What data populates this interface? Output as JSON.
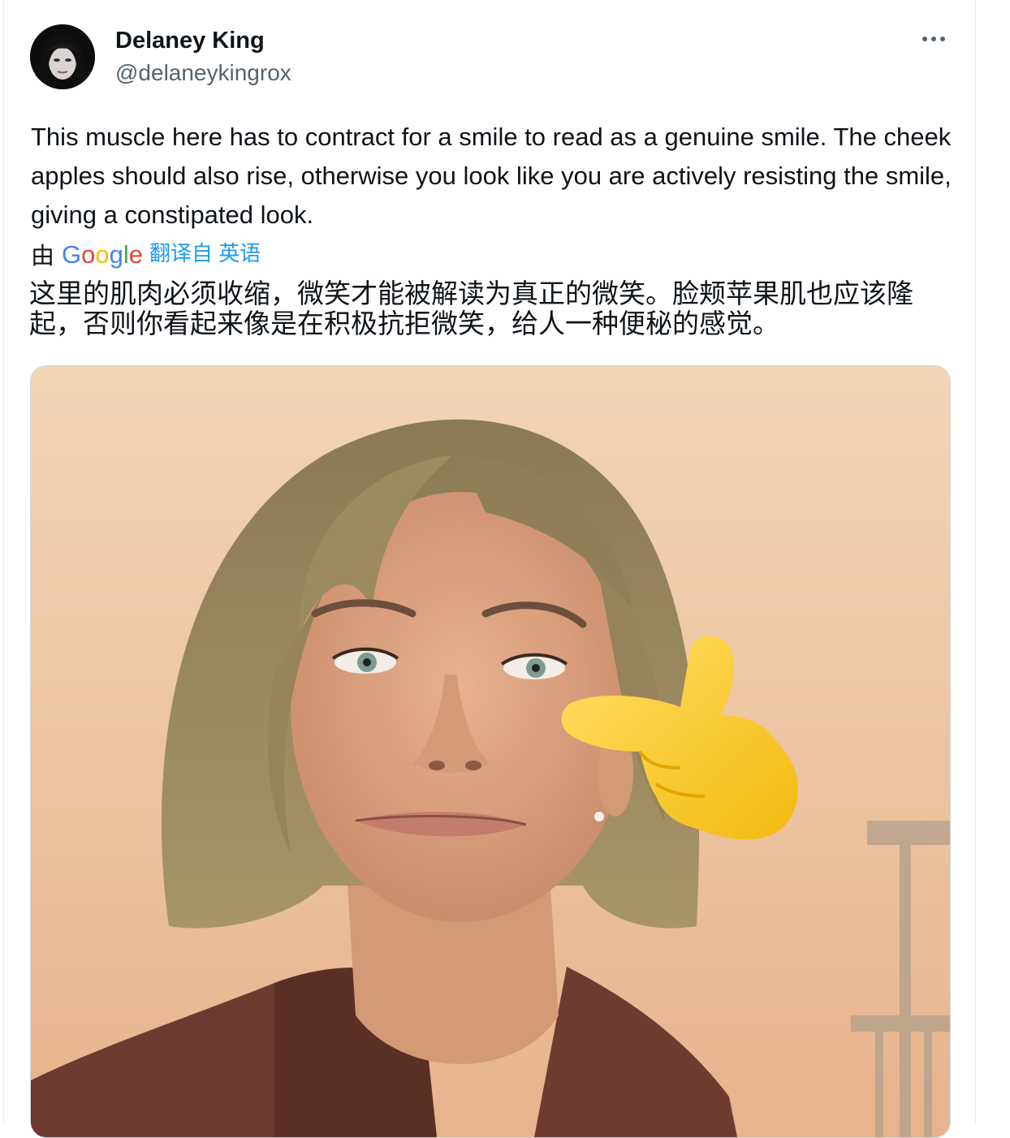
{
  "tweet": {
    "author": {
      "display_name": "Delaney King",
      "handle": "@delaneykingrox"
    },
    "text": "This muscle here has to contract for a smile to read as a genuine smile. The cheek apples should also rise, otherwise you look like you are actively resisting the smile, giving a constipated look.",
    "translation": {
      "by_label": "由",
      "provider": "Google",
      "translated_from_label": "翻译自 英语",
      "text": "这里的肌肉必须收缩，微笑才能被解读为真正的微笑。脸颊苹果肌也应该隆起，否则你看起来像是在积极抗拒微笑，给人一种便秘的感觉。"
    }
  },
  "icons": {
    "more": "more-options-icon",
    "pointing_hand": "backhand-index-pointing-left-icon"
  },
  "colors": {
    "text_primary": "#0f1419",
    "text_secondary": "#536471",
    "link": "#1d9bf0",
    "border": "#cfd9de",
    "image_background": "#f0c9a6"
  }
}
